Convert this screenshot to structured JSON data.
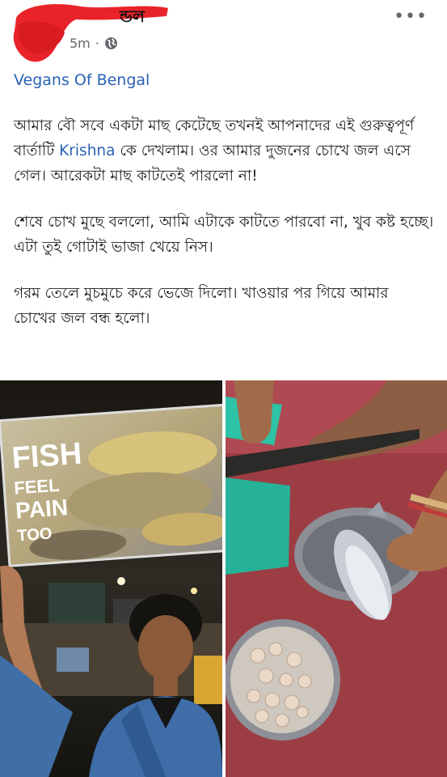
{
  "post": {
    "author_suffix": "ন্ডল",
    "time": "5m",
    "time_sep": "·",
    "group": "Vegans Of Bengal",
    "more_label": "•••"
  },
  "body": {
    "p1_a": "আমার বৌ সবে একটা মাছ কেটেছে তখনই আপনাদের এই গুরুত্বপূর্ণ বার্তাটি ",
    "p1_mention": "Krishna",
    "p1_b": " কে দেখলাম। ওর আমার দুজনের চোখে জল এসে গেল। আরেকটা মাছ কাটতেই পারলো না!",
    "p2": "শেষে চোখ মুছে বললো, আমি এটাকে কাটতে পারবো না, খুব কষ্ট হচ্ছে। এটা তুই গোটাই ভাজা খেয়ে নিস।",
    "p3": "গরম তেলে মুচমুচে করে ভেজে দিলো। খাওয়ার পর গিয়ে আমার চোখের জল বন্ধ হলো।"
  },
  "photo_left": {
    "sign_line1": "FISH",
    "sign_line2": "FEEL",
    "sign_line3": "PAIN",
    "sign_line4": "TOO"
  },
  "colors": {
    "link": "#2a62b4",
    "redaction": "#e8242a"
  }
}
